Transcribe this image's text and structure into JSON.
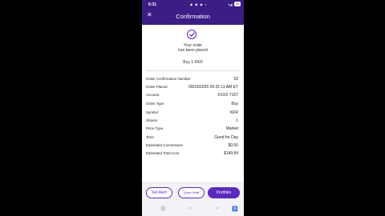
{
  "status_bar": {
    "time": "6:31",
    "icons": "◆ ◆ ◆ ▪",
    "signal": "▾◢",
    "battery": "71"
  },
  "header": {
    "title": "Confirmation"
  },
  "confirmation": {
    "line1": "Your order",
    "line2": "has been placed",
    "summary": "Buy 1 KKR"
  },
  "details": [
    {
      "label": "Order Confirmation Number",
      "value": "53"
    },
    {
      "label": "Order Placed",
      "value": "09/15/2025 09:31:11 AM ET"
    },
    {
      "label": "Account",
      "value": "XXXX 7157"
    },
    {
      "label": "Order Type",
      "value": "Buy"
    },
    {
      "label": "Symbol",
      "value": "KKR"
    },
    {
      "label": "Shares",
      "value": "1"
    },
    {
      "label": "Price Type",
      "value": "Market"
    },
    {
      "label": "Term",
      "value": "Good for Day"
    },
    {
      "label": "Estimated Commission",
      "value": "$0.00"
    },
    {
      "label": "Estimated Total Cost",
      "value": "$149.84"
    }
  ],
  "actions": {
    "alert": "Set Alert",
    "details": "Quote Detail",
    "portfolio": "Portfolio"
  },
  "nav": {
    "recents": "|||",
    "home": "○",
    "back": "‹",
    "accessibility": "♿"
  },
  "colors": {
    "header": "#3b1d86",
    "accent": "#5b2bbd"
  }
}
